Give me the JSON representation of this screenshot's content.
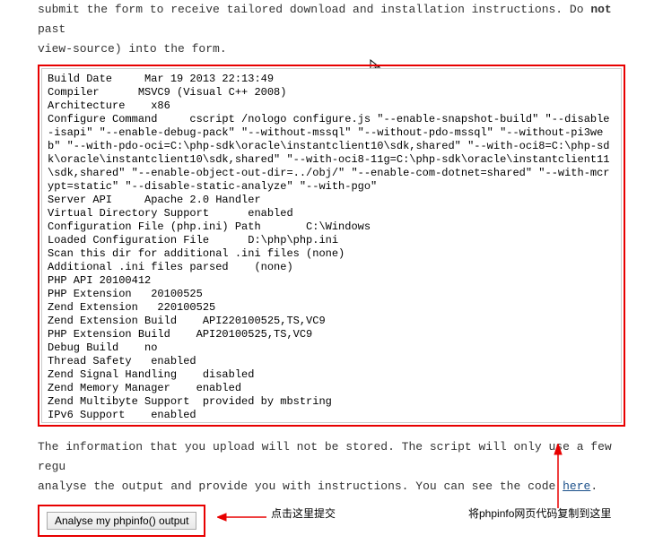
{
  "intro": {
    "line1_pre": "submit the form to receive tailored download and installation instructions. Do ",
    "line1_bold": "not",
    "line1_post": " past",
    "line2": "view-source) into the form."
  },
  "phpinfo_text": "Build Date     Mar 19 2013 22:13:49\nCompiler      MSVC9 (Visual C++ 2008)\nArchitecture    x86\nConfigure Command     cscript /nologo configure.js \"--enable-snapshot-build\" \"--disable-isapi\" \"--enable-debug-pack\" \"--without-mssql\" \"--without-pdo-mssql\" \"--without-pi3web\" \"--with-pdo-oci=C:\\php-sdk\\oracle\\instantclient10\\sdk,shared\" \"--with-oci8=C:\\php-sdk\\oracle\\instantclient10\\sdk,shared\" \"--with-oci8-11g=C:\\php-sdk\\oracle\\instantclient11\\sdk,shared\" \"--enable-object-out-dir=../obj/\" \"--enable-com-dotnet=shared\" \"--with-mcrypt=static\" \"--disable-static-analyze\" \"--with-pgo\"\nServer API     Apache 2.0 Handler\nVirtual Directory Support      enabled\nConfiguration File (php.ini) Path       C:\\Windows\nLoaded Configuration File      D:\\php\\php.ini\nScan this dir for additional .ini files (none)\nAdditional .ini files parsed    (none)\nPHP API 20100412\nPHP Extension   20100525\nZend Extension   220100525\nZend Extension Build    API220100525,TS,VC9\nPHP Extension Build    API20100525,TS,VC9\nDebug Build    no\nThread Safety   enabled\nZend Signal Handling    disabled\nZend Memory Manager    enabled\nZend Multibyte Support  provided by mbstring\nIPv6 Support    enabled",
  "midtext": {
    "line1": "The information that you upload will not be stored. The script will only use a few regu",
    "line2_pre": "analyse the output and provide you with instructions. You can see the code ",
    "line2_link": "here",
    "line2_post": "."
  },
  "button_label": "Analyse my phpinfo() output",
  "annotations": {
    "left": "点击这里提交",
    "right": "将phpinfo网页代码复制到这里"
  }
}
